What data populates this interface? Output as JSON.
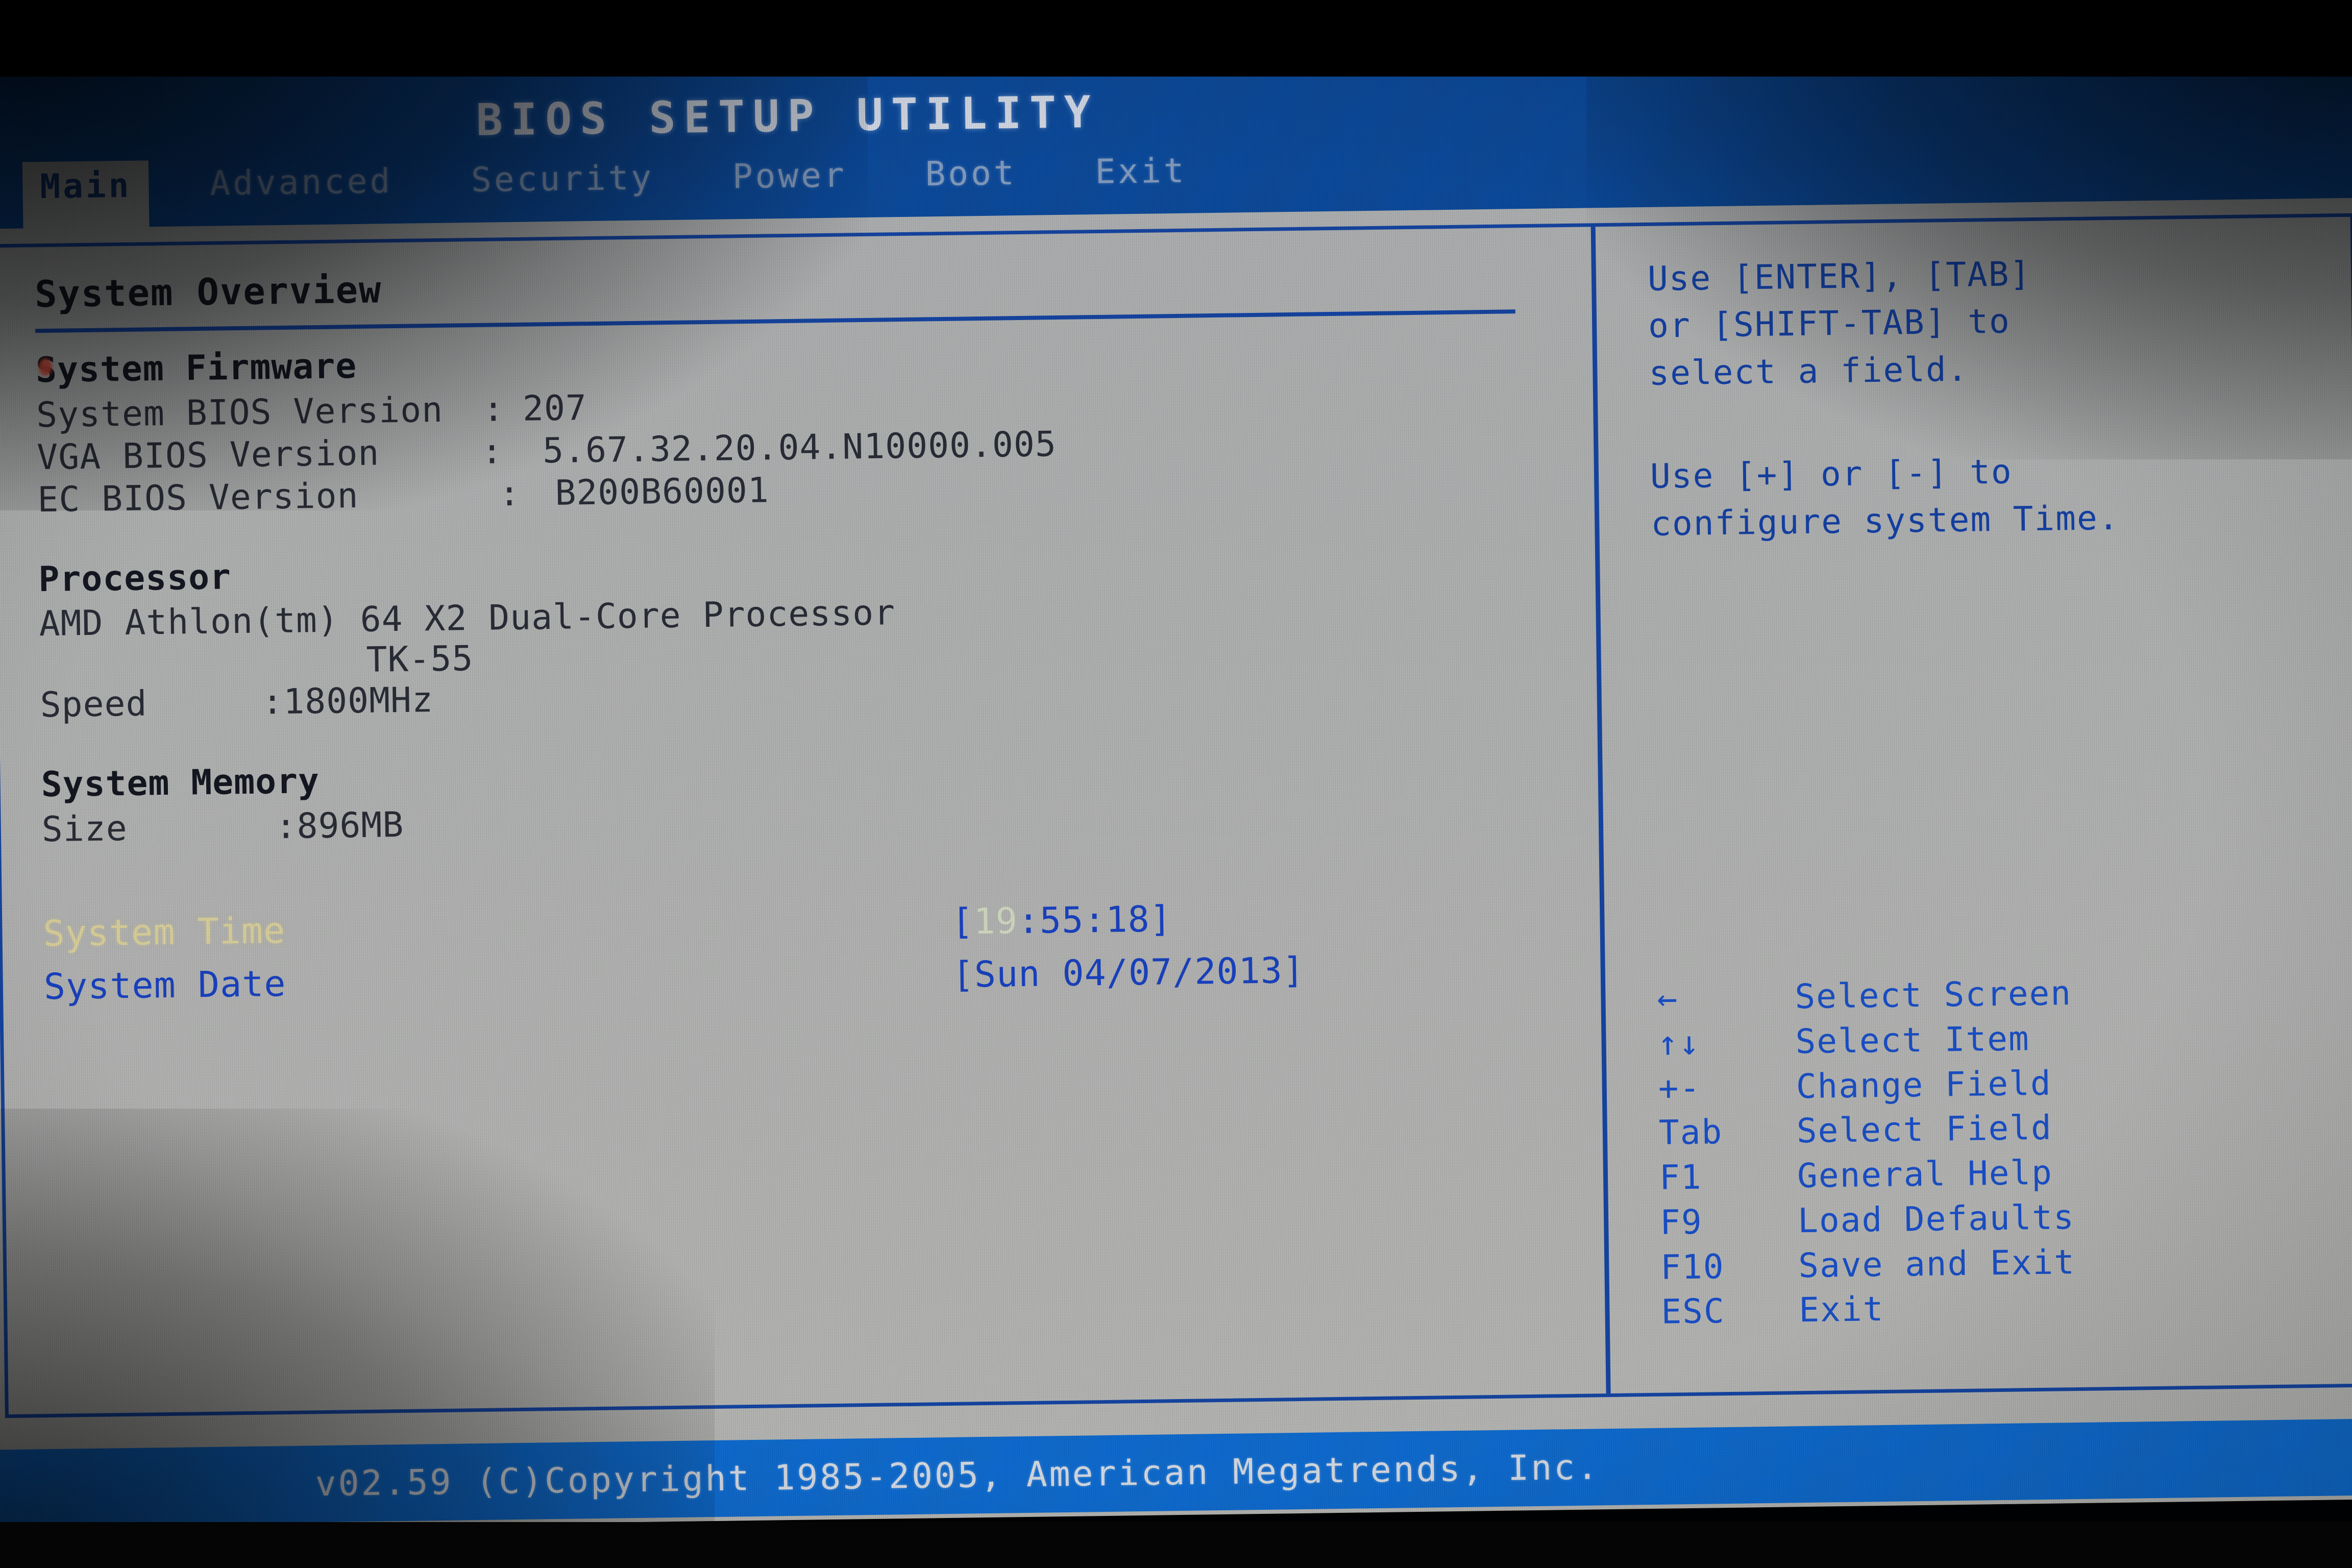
{
  "window": {
    "title": "BIOS SETUP UTILITY",
    "vendor_footer": "v02.59 (C)Copyright 1985-2005, American Megatrends, Inc."
  },
  "menu": {
    "tabs": [
      {
        "label": "Main",
        "active": true
      },
      {
        "label": "Advanced",
        "active": false
      },
      {
        "label": "Security",
        "active": false
      },
      {
        "label": "Power",
        "active": false
      },
      {
        "label": "Boot",
        "active": false
      },
      {
        "label": "Exit",
        "active": false
      }
    ]
  },
  "main": {
    "page_title": "System Overview",
    "firmware": {
      "heading": "System Firmware",
      "rows": [
        {
          "label": "System BIOS Version",
          "sep": ":",
          "value": "207"
        },
        {
          "label": "VGA BIOS Version",
          "sep": ":",
          "value": "5.67.32.20.04.N10000.005"
        },
        {
          "label": "EC BIOS Version",
          "sep": ":",
          "value": "B200B60001"
        }
      ]
    },
    "processor": {
      "heading": "Processor",
      "name": "AMD Athlon(tm) 64 X2 Dual-Core Processor",
      "model": "TK-55",
      "speed_label": "Speed",
      "speed_value": ":1800MHz"
    },
    "memory": {
      "heading": "System Memory",
      "size_label": "Size",
      "size_value": ":896MB"
    },
    "clock": {
      "time_label": "System Time",
      "time_value_prefix": "[",
      "time_hour": "19",
      "time_rest": ":55:18]",
      "date_label": "System Date",
      "date_value": "[Sun 04/07/2013]"
    }
  },
  "help": {
    "lines": [
      "Use [ENTER], [TAB]",
      "or [SHIFT-TAB] to",
      "select a field."
    ],
    "lines2": [
      "Use [+] or [-] to",
      "configure system Time."
    ],
    "keys": [
      {
        "key": "←",
        "desc": "Select Screen"
      },
      {
        "key": "↑↓",
        "desc": "Select Item"
      },
      {
        "key": "+-",
        "desc": "Change Field"
      },
      {
        "key": "Tab",
        "desc": "Select Field"
      },
      {
        "key": "F1",
        "desc": "General Help"
      },
      {
        "key": "F9",
        "desc": "Load Defaults"
      },
      {
        "key": "F10",
        "desc": "Save and Exit"
      },
      {
        "key": "ESC",
        "desc": "Exit"
      }
    ]
  },
  "colors": {
    "header_blue": "#0b4ea2",
    "footer_blue": "#0f6fd6",
    "panel_gray": "#bdbdb9",
    "accent_blue": "#1547a8",
    "text_blue": "#1a44c8",
    "selected_yellow": "#e8dca0",
    "body_text": "#2b2d33"
  }
}
